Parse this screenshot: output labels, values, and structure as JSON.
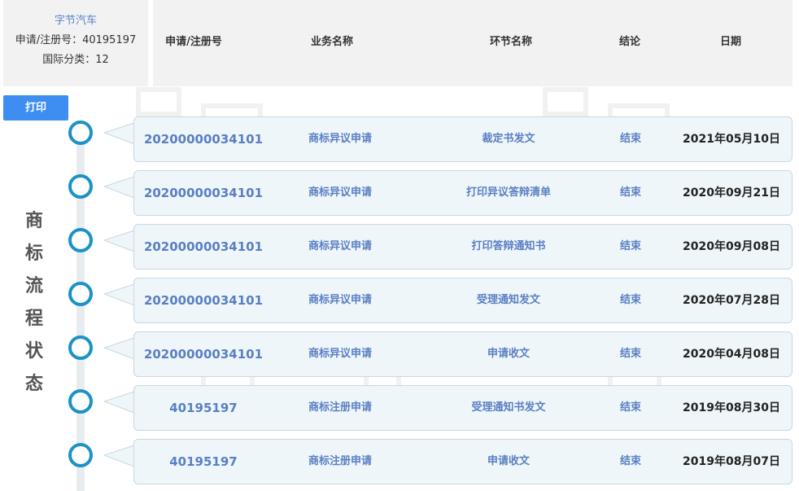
{
  "info": {
    "brand": "字节汽车",
    "reg_line": "申请/注册号：40195197",
    "class_line": "国际分类：12"
  },
  "header": {
    "col_no": "申请/注册号",
    "col_biz": "业务名称",
    "col_step": "环节名称",
    "col_result": "结论",
    "col_date": "日期"
  },
  "print_label": "打印",
  "side_title": [
    "商",
    "标",
    "流",
    "程",
    "状",
    "态"
  ],
  "rows": [
    {
      "no": "20200000034101",
      "biz": "商标异议申请",
      "step": "裁定书发文",
      "result": "结束",
      "date": "2021年05月10日"
    },
    {
      "no": "20200000034101",
      "biz": "商标异议申请",
      "step": "打印异议答辩清单",
      "result": "结束",
      "date": "2020年09月21日"
    },
    {
      "no": "20200000034101",
      "biz": "商标异议申请",
      "step": "打印答辩通知书",
      "result": "结束",
      "date": "2020年09月08日"
    },
    {
      "no": "20200000034101",
      "biz": "商标异议申请",
      "step": "受理通知发文",
      "result": "结束",
      "date": "2020年07月28日"
    },
    {
      "no": "20200000034101",
      "biz": "商标异议申请",
      "step": "申请收文",
      "result": "结束",
      "date": "2020年04月08日"
    },
    {
      "no": "40195197",
      "biz": "商标注册申请",
      "step": "受理通知书发文",
      "result": "结束",
      "date": "2019年08月30日"
    },
    {
      "no": "40195197",
      "biz": "商标注册申请",
      "step": "申请收文",
      "result": "结束",
      "date": "2019年08月07日"
    }
  ]
}
